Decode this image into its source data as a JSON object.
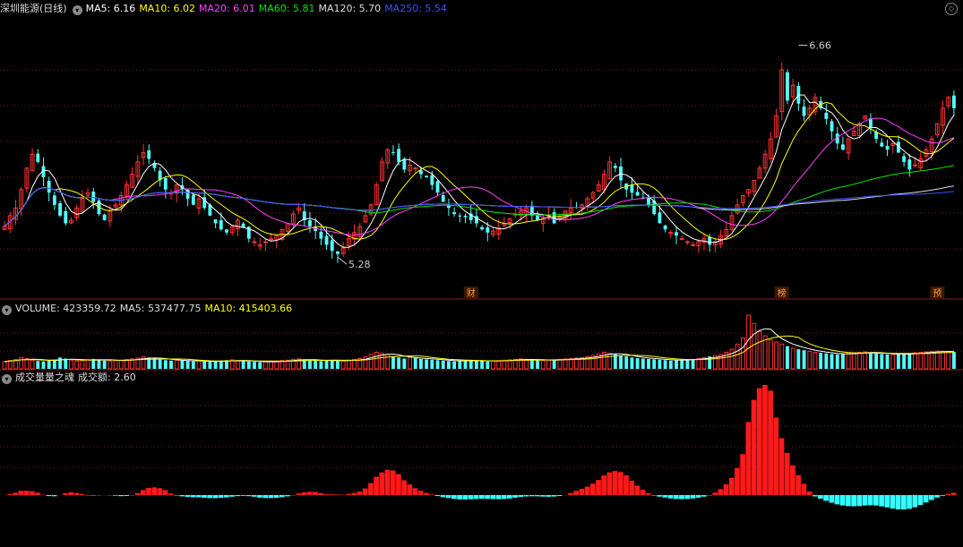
{
  "price_header": {
    "stock_name": "深圳能源(日线)",
    "ma5": "MA5: 6.16",
    "ma10": "MA10: 6.02",
    "ma20": "MA20: 6.01",
    "ma60": "MA60: 5.81",
    "ma120": "MA120: 5.70",
    "ma250": "MA250: 5.54"
  },
  "volume_header": {
    "volume": "VOLUME: 423359.72",
    "ma5": "MA5: 537477.75",
    "ma10": "MA10: 415403.66"
  },
  "indicator_header": {
    "name": "成交量量之魂",
    "value": "成交额: 2.60"
  },
  "colors": {
    "up": "#ff3232",
    "down": "#54ffff",
    "ma5": "#ffffff",
    "ma10": "#ffff00",
    "ma20": "#ff40ff",
    "ma60": "#00e600",
    "ma120": "#dddddd",
    "ma250": "#3c50ff",
    "grid": "#7a1a1a"
  },
  "chart_data": [
    {
      "type": "candlestick",
      "title": "深圳能源(日线)",
      "ylim": [
        5.1,
        6.85
      ],
      "annotations": [
        {
          "label": "6.66",
          "index": 143,
          "value": 6.66,
          "kind": "high"
        },
        {
          "label": "5.28",
          "index": 60,
          "value": 5.28,
          "kind": "low"
        }
      ],
      "event_markers": [
        {
          "label": "财",
          "index": 84
        },
        {
          "label": "榜",
          "index": 140
        },
        {
          "label": "预",
          "index": 168
        }
      ],
      "ma_lines": [
        {
          "name": "MA5",
          "value": 6.16
        },
        {
          "name": "MA10",
          "value": 6.02
        },
        {
          "name": "MA20",
          "value": 6.01
        },
        {
          "name": "MA60",
          "value": 5.81
        },
        {
          "name": "MA120",
          "value": 5.7
        },
        {
          "name": "MA250",
          "value": 5.54
        }
      ],
      "close_series": [
        5.48,
        5.55,
        5.6,
        5.72,
        5.86,
        5.95,
        5.9,
        5.8,
        5.7,
        5.62,
        5.55,
        5.5,
        5.52,
        5.6,
        5.66,
        5.7,
        5.64,
        5.56,
        5.52,
        5.58,
        5.62,
        5.68,
        5.75,
        5.82,
        5.9,
        5.96,
        5.92,
        5.86,
        5.78,
        5.72,
        5.7,
        5.75,
        5.72,
        5.66,
        5.62,
        5.66,
        5.6,
        5.55,
        5.5,
        5.46,
        5.44,
        5.48,
        5.52,
        5.47,
        5.4,
        5.38,
        5.36,
        5.38,
        5.4,
        5.42,
        5.46,
        5.5,
        5.56,
        5.6,
        5.52,
        5.48,
        5.45,
        5.4,
        5.36,
        5.32,
        5.3,
        5.34,
        5.4,
        5.44,
        5.48,
        5.55,
        5.62,
        5.75,
        5.9,
        5.98,
        5.96,
        5.9,
        5.85,
        5.88,
        5.86,
        5.82,
        5.8,
        5.75,
        5.7,
        5.64,
        5.6,
        5.56,
        5.55,
        5.54,
        5.52,
        5.5,
        5.46,
        5.44,
        5.45,
        5.47,
        5.5,
        5.53,
        5.56,
        5.58,
        5.6,
        5.55,
        5.52,
        5.53,
        5.55,
        5.5,
        5.54,
        5.58,
        5.6,
        5.6,
        5.62,
        5.66,
        5.7,
        5.75,
        5.82,
        5.9,
        5.86,
        5.78,
        5.72,
        5.7,
        5.68,
        5.66,
        5.62,
        5.56,
        5.5,
        5.46,
        5.44,
        5.42,
        5.4,
        5.38,
        5.36,
        5.38,
        5.4,
        5.36,
        5.38,
        5.42,
        5.46,
        5.55,
        5.62,
        5.68,
        5.72,
        5.78,
        5.86,
        5.95,
        6.05,
        6.2,
        6.5,
        6.3,
        6.4,
        6.28,
        6.2,
        6.25,
        6.32,
        6.25,
        6.18,
        6.1,
        6.02,
        5.98,
        6.05,
        6.1,
        6.15,
        6.2,
        6.12,
        6.05,
        6.0,
        5.98,
        6.02,
        5.96,
        5.9,
        5.85,
        5.88,
        5.92,
        5.98,
        6.05,
        6.15,
        6.25,
        6.32,
        6.25
      ],
      "volume_series": [
        35,
        40,
        45,
        55,
        50,
        42,
        38,
        36,
        40,
        45,
        55,
        50,
        42,
        38,
        40,
        45,
        48,
        44,
        40,
        38,
        40,
        42,
        45,
        48,
        52,
        58,
        55,
        50,
        45,
        42,
        40,
        42,
        40,
        38,
        36,
        38,
        36,
        34,
        36,
        40,
        42,
        44,
        40,
        38,
        36,
        34,
        32,
        34,
        36,
        38,
        40,
        42,
        46,
        48,
        44,
        42,
        40,
        38,
        40,
        42,
        40,
        38,
        42,
        46,
        50,
        58,
        70,
        80,
        75,
        70,
        60,
        55,
        50,
        55,
        52,
        48,
        46,
        44,
        42,
        40,
        38,
        36,
        38,
        40,
        42,
        40,
        38,
        36,
        38,
        40,
        42,
        44,
        46,
        48,
        46,
        44,
        42,
        40,
        42,
        44,
        46,
        48,
        50,
        52,
        54,
        58,
        65,
        72,
        80,
        75,
        70,
        65,
        60,
        55,
        52,
        50,
        48,
        46,
        44,
        42,
        40,
        42,
        44,
        46,
        48,
        50,
        55,
        60,
        65,
        70,
        80,
        95,
        120,
        150,
        260,
        220,
        180,
        160,
        140,
        130,
        120,
        110,
        100,
        95,
        90,
        85,
        80,
        78,
        75,
        72,
        70,
        72,
        75,
        78,
        80,
        82,
        80,
        76,
        72,
        70,
        68,
        70,
        72,
        75,
        78,
        80,
        82,
        84,
        86,
        85,
        84,
        82
      ]
    }
  ]
}
